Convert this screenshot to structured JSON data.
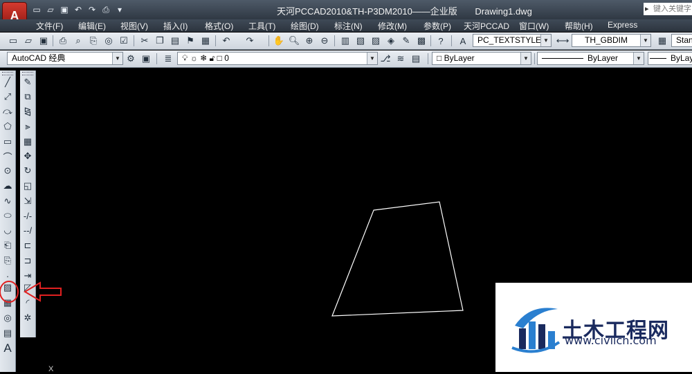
{
  "titlebar": {
    "app_letter": "A",
    "product": "天河PCCAD2010&TH-P3DM2010——企业版",
    "document": "Drawing1.dwg",
    "search_placeholder": "键入关键字"
  },
  "menu": [
    "文件(F)",
    "编辑(E)",
    "视图(V)",
    "插入(I)",
    "格式(O)",
    "工具(T)",
    "绘图(D)",
    "标注(N)",
    "修改(M)",
    "参数(P)",
    "天河PCCAD",
    "窗口(W)",
    "帮助(H)",
    "Express"
  ],
  "standard_toolbar": {
    "text_style": "PC_TEXTSTYLE",
    "dim_style": "TH_GBDIM",
    "table_style": "Stan"
  },
  "layers_toolbar": {
    "workspace": "AutoCAD 经典",
    "layer": "0",
    "color": "ByLayer",
    "linetype": "ByLayer",
    "lineweight": "ByLay"
  },
  "colors": {
    "canvas": "#000000",
    "shape_stroke": "#ffffff",
    "annotation": "#e02020",
    "watermark_text": "#1a2a5e"
  },
  "watermark": {
    "title": "土木工程网",
    "url": "www.civilcn.com"
  },
  "canvas": {
    "ucs_label": "X"
  }
}
